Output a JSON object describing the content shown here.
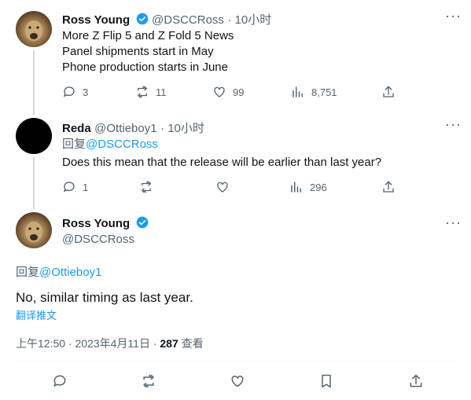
{
  "tweet1": {
    "name": "Ross Young",
    "handle": "@DSCCRoss",
    "time": "· 10小时",
    "lines": [
      "More Z Flip 5 and Z Fold 5 News",
      "Panel shipments start in May",
      "Phone production starts in June"
    ],
    "replies": "3",
    "retweets": "11",
    "likes": "99",
    "views": "8,751"
  },
  "tweet2": {
    "name": "Reda",
    "handle": "@Ottieboy1",
    "time": "· 10小时",
    "reply_prefix": "回复",
    "reply_to": "@DSCCRoss",
    "text": "Does this mean that the release will be earlier than last year?",
    "replies": "1",
    "views": "296"
  },
  "tweet3": {
    "name": "Ross Young",
    "handle": "@DSCCRoss",
    "reply_prefix": "回复",
    "reply_to": "@Ottieboy1",
    "text": "No, similar timing as last year.",
    "translate": "翻译推文",
    "timestamp": "上午12:50 · 2023年4月11日 ·",
    "views_count": "287",
    "views_label": "查看"
  },
  "colors": {
    "accent": "#1d9bf0",
    "muted": "#536471",
    "divider": "#eff3f4"
  }
}
